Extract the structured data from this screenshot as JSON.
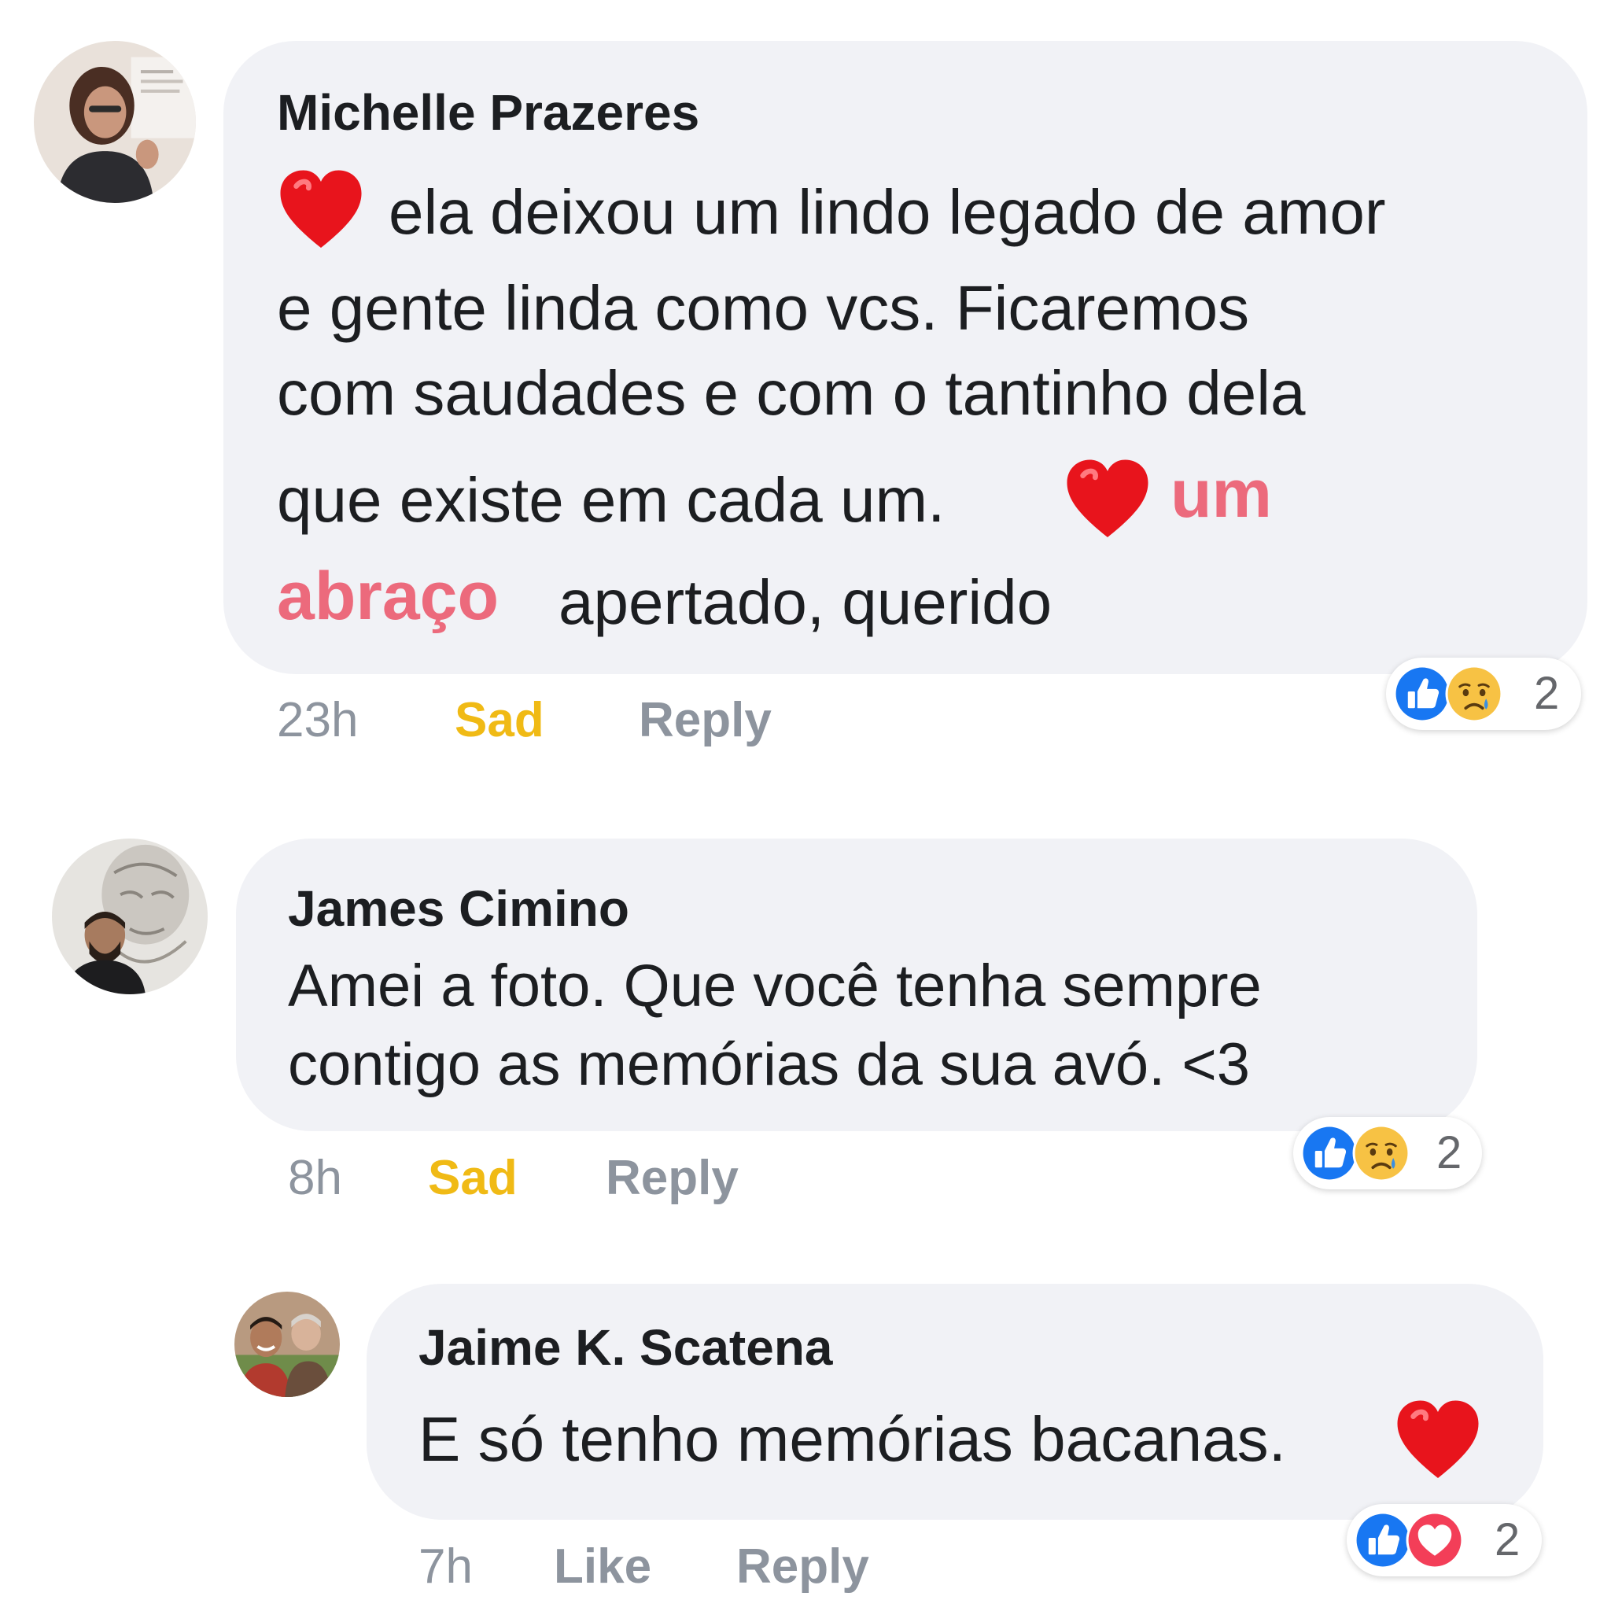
{
  "comments": [
    {
      "author": "Michelle Prazeres",
      "lines": [
        "ela deixou um lindo legado de amor",
        "e gente linda como vcs. Ficaremos",
        "com saudades e com o tantinho dela",
        "que existe em cada um.",
        "um",
        "abraço",
        "apertado, querido"
      ],
      "time": "23h",
      "reaction_action": "Sad",
      "reply_label": "Reply",
      "reaction_icons": [
        "like-icon",
        "sad-face-icon"
      ],
      "reaction_count": "2"
    },
    {
      "author": "James Cimino",
      "lines": [
        "Amei a foto. Que você tenha sempre",
        "contigo as memórias da sua avó. <3"
      ],
      "time": "8h",
      "reaction_action": "Sad",
      "reply_label": "Reply",
      "reaction_icons": [
        "like-icon",
        "sad-face-icon"
      ],
      "reaction_count": "2"
    },
    {
      "author": "Jaime K. Scatena",
      "lines": [
        "E só tenho memórias bacanas."
      ],
      "time": "7h",
      "reaction_action": "Like",
      "reply_label": "Reply",
      "reaction_icons": [
        "like-icon",
        "love-icon"
      ],
      "reaction_count": "2"
    }
  ],
  "colors": {
    "bubble": "#f1f2f6",
    "accent_text": "#ec6a7c",
    "sad_action": "#f0ba15",
    "muted": "#8d949e",
    "like_blue": "#1877f2",
    "love_red": "#f33e58"
  }
}
